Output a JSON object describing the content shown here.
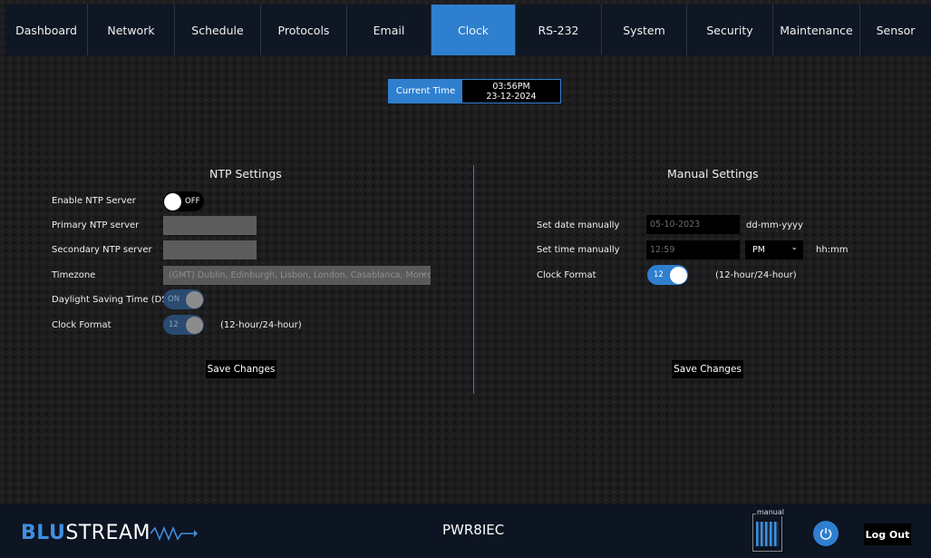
{
  "nav": {
    "tabs": [
      {
        "label": "Dashboard"
      },
      {
        "label": "Network"
      },
      {
        "label": "Schedule"
      },
      {
        "label": "Protocols"
      },
      {
        "label": "Email"
      },
      {
        "label": "Clock",
        "active": true
      },
      {
        "label": "RS-232"
      },
      {
        "label": "System"
      },
      {
        "label": "Security"
      },
      {
        "label": "Maintenance"
      },
      {
        "label": "Sensor"
      }
    ]
  },
  "current_time": {
    "label": "Current Time",
    "time": "03:56PM",
    "date": "23-12-2024"
  },
  "ntp": {
    "title": "NTP Settings",
    "enable_label": "Enable NTP Server",
    "enable_state": "OFF",
    "primary_label": "Primary NTP server",
    "secondary_label": "Secondary NTP server",
    "timezone_label": "Timezone",
    "timezone_value": "(GMT) Dublin, Edinburgh, Lisbon, London, Casablanca, Monrovia",
    "dst_label": "Daylight Saving Time (DST)",
    "dst_state": "ON",
    "clock_format_label": "Clock Format",
    "clock_format_value": "12",
    "clock_format_hint": "(12-hour/24-hour)",
    "save_label": "Save Changes"
  },
  "manual": {
    "title": "Manual Settings",
    "date_label": "Set date manually",
    "date_placeholder": "05-10-2023",
    "date_format": "dd-mm-yyyy",
    "time_label": "Set time manually",
    "time_placeholder": "12:59",
    "ampm_value": "PM",
    "time_format": "hh:mm",
    "clock_format_label": "Clock Format",
    "clock_format_value": "12",
    "clock_format_hint": "(12-hour/24-hour)",
    "save_label": "Save Changes"
  },
  "footer": {
    "logo_blu": "BLU",
    "logo_stream": "STREAM",
    "device_name": "PWR8IEC",
    "manual_label": "manual",
    "logout_label": "Log Out"
  },
  "colors": {
    "accent": "#2f7fcf",
    "nav_bg": "#0f1624",
    "footer_bg": "#0d1422"
  }
}
